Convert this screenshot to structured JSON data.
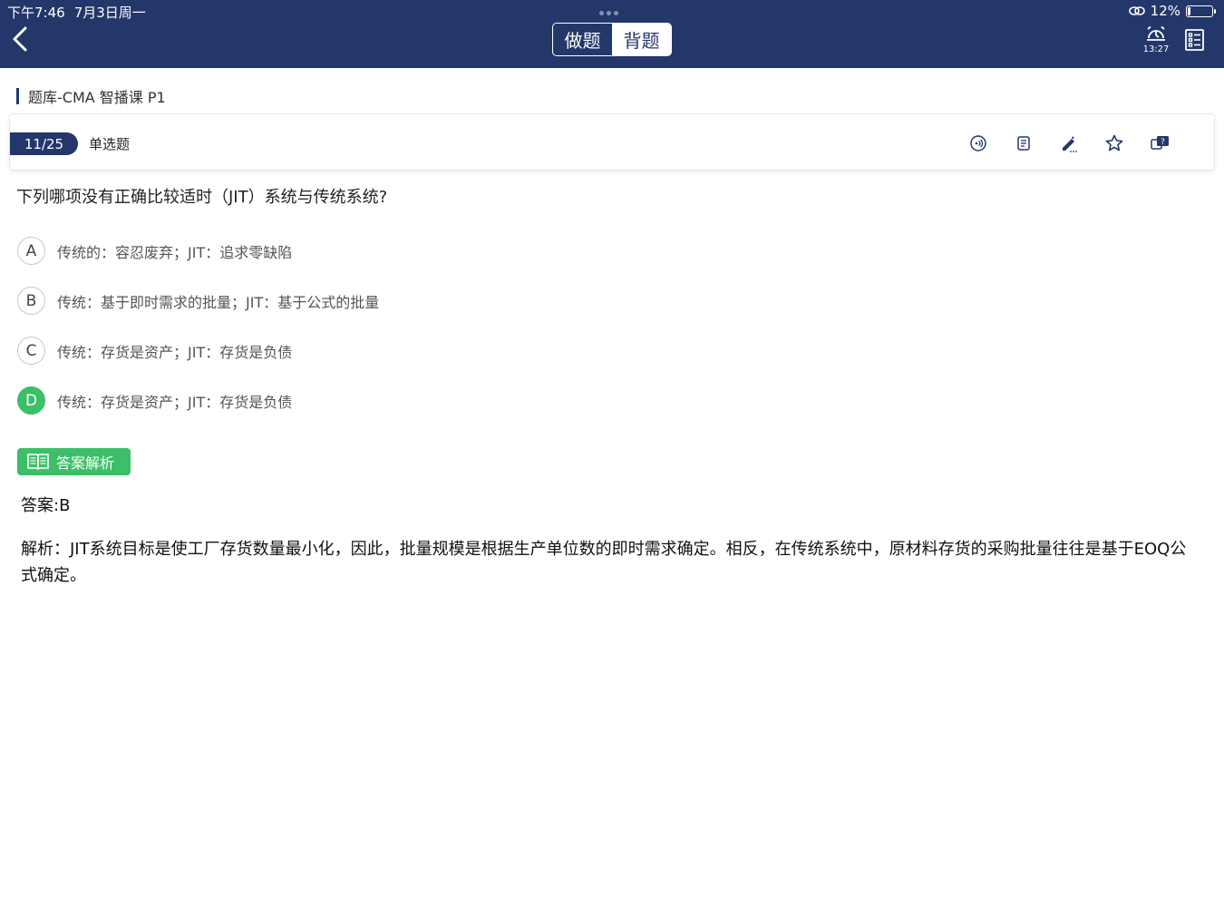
{
  "status_bar": {
    "time": "下午7:46",
    "date": "7月3日周一",
    "battery_text": "12%",
    "battery_level": 0.12
  },
  "header": {
    "mode_practice": "做题",
    "mode_memorize": "背题",
    "active_mode": "背题",
    "timer_value": "13:27"
  },
  "breadcrumb": {
    "title": "题库-CMA 智播课 P1"
  },
  "question_bar": {
    "progress": "11/25",
    "type": "单选题"
  },
  "question": {
    "stem": "下列哪项没有正确比较适时（JIT）系统与传统系统?",
    "options": [
      {
        "letter": "A",
        "text": "传统的：容忍废弃；JIT：追求零缺陷"
      },
      {
        "letter": "B",
        "text": "传统：基于即时需求的批量；JIT：基于公式的批量"
      },
      {
        "letter": "C",
        "text": "传统：存货是资产；JIT：存货是负债"
      },
      {
        "letter": "D",
        "text": "传统：存货是资产；JIT：存货是负债"
      }
    ],
    "selected": "D"
  },
  "analysis": {
    "tag_label": "答案解析",
    "answer": "答案:B",
    "explanation": "解析：JIT系统目标是使工厂存货数量最小化，因此，批量规模是根据生产单位数的即时需求确定。相反，在传统系统中，原材料存货的采购批量往往是基于EOQ公式确定。"
  },
  "colors": {
    "header_bg": "#23376a",
    "accent_green": "#3dbf6a",
    "progress_bg": "#23376a"
  },
  "icons": {
    "back": "chevron-left-icon",
    "timer": "alarm-clock-icon",
    "answer_sheet": "list-sheet-icon",
    "audio": "audio-icon",
    "notes": "note-icon",
    "edit": "pencil-icon",
    "favorite": "star-icon",
    "ask": "question-bubble-icon",
    "analysis": "book-icon"
  }
}
